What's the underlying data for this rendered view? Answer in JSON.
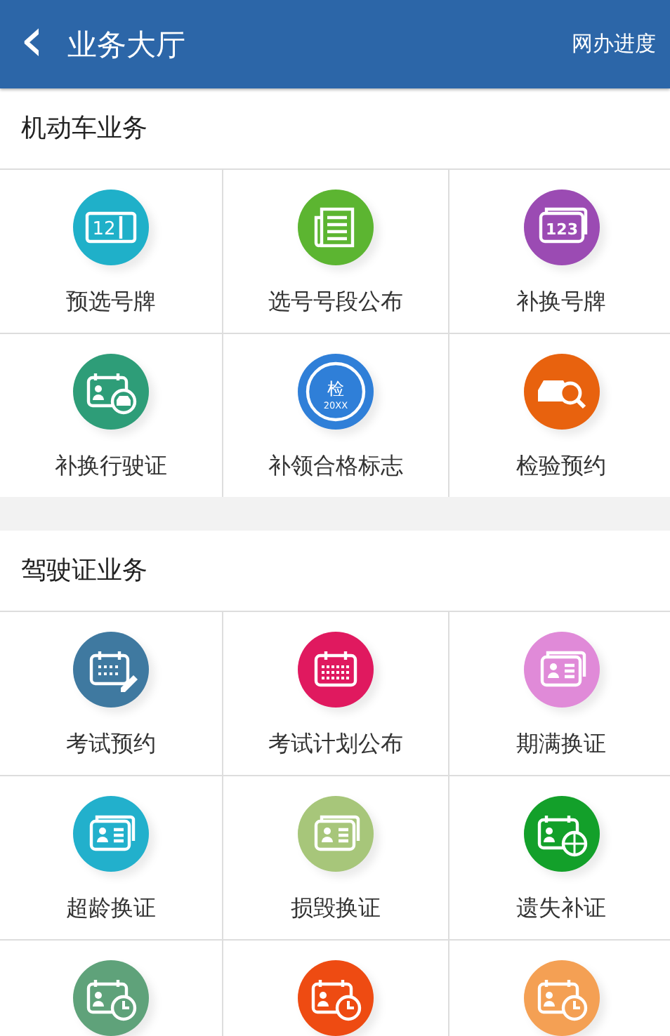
{
  "header": {
    "back_icon": "‹",
    "title": "业务大厅",
    "action": "网办进度"
  },
  "sections": [
    {
      "title": "机动车业务",
      "items": [
        {
          "label": "预选号牌",
          "kind": "plate",
          "icon_text": "12",
          "color": "#1fb0c9"
        },
        {
          "label": "选号号段公布",
          "kind": "news",
          "color": "#5cb531"
        },
        {
          "label": "补换号牌",
          "kind": "plate-box",
          "icon_text": "123",
          "color": "#9b4bb3"
        },
        {
          "label": "补换行驶证",
          "kind": "card-car",
          "color": "#2e9d78"
        },
        {
          "label": "补领合格标志",
          "kind": "seal",
          "icon_text": "检",
          "icon_subtext": "20XX",
          "color": "#2f7fd8"
        },
        {
          "label": "检验预约",
          "kind": "car-search",
          "color": "#e8620e"
        }
      ]
    },
    {
      "title": "驾驶证业务",
      "items": [
        {
          "label": "考试预约",
          "kind": "calendar-pen",
          "color": "#3f79a0"
        },
        {
          "label": "考试计划公布",
          "kind": "calendar",
          "color": "#e0195f"
        },
        {
          "label": "期满换证",
          "kind": "card",
          "color": "#e08ad8"
        },
        {
          "label": "超龄换证",
          "kind": "card",
          "color": "#22b0cc"
        },
        {
          "label": "损毁换证",
          "kind": "card",
          "color": "#a7c67a"
        },
        {
          "label": "遗失补证",
          "kind": "card-globe",
          "color": "#13a02a"
        },
        {
          "kind": "card-clock",
          "color": "#5fa27a"
        },
        {
          "kind": "card-clock",
          "color": "#ee4b12"
        },
        {
          "kind": "card-clock",
          "color": "#f4a054"
        }
      ]
    }
  ]
}
